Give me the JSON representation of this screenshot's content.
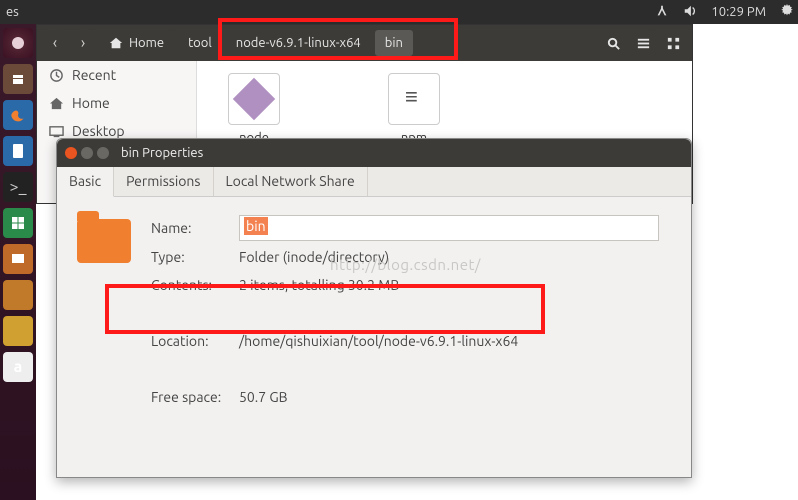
{
  "panel": {
    "es_label": "es",
    "time": "10:29 PM"
  },
  "fm": {
    "crumb_home": "Home",
    "crumbs": [
      "tool",
      "node-v6.9.1-linux-x64",
      "bin"
    ],
    "sidebar": {
      "recent": "Recent",
      "home": "Home",
      "desktop": "Desktop"
    },
    "files": {
      "node": "node",
      "npm": "npm"
    }
  },
  "props": {
    "title": "bin Properties",
    "tabs": {
      "basic": "Basic",
      "permissions": "Permissions",
      "lns": "Local Network Share"
    },
    "labels": {
      "name": "Name:",
      "type": "Type:",
      "contents": "Contents:",
      "location": "Location:",
      "free": "Free space:"
    },
    "values": {
      "name": "bin",
      "type": "Folder (inode/directory)",
      "contents": "2 items, totalling 30.2 MB",
      "location": "/home/qishuixian/tool/node-v6.9.1-linux-x64",
      "free": "50.7 GB"
    }
  },
  "watermark": "http://blog.csdn.net/"
}
